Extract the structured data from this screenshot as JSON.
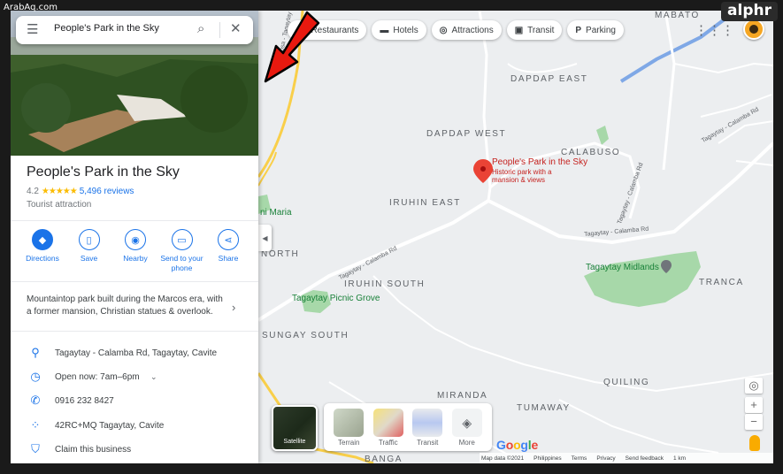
{
  "watermark": "ArabAq.com",
  "brand": "alphr",
  "search": {
    "value": "People's Park in the Sky"
  },
  "place": {
    "name": "People's Park in the Sky",
    "rating": "4.2",
    "stars": "★★★★★",
    "reviews": "5,496 reviews",
    "category": "Tourist attraction",
    "description": "Mountaintop park built during the Marcos era, with a former mansion, Christian statues & overlook."
  },
  "actions": [
    {
      "label": "Directions",
      "icon": "directions-icon"
    },
    {
      "label": "Save",
      "icon": "bookmark-icon"
    },
    {
      "label": "Nearby",
      "icon": "nearby-icon"
    },
    {
      "label": "Send to your phone",
      "icon": "phone-send-icon"
    },
    {
      "label": "Share",
      "icon": "share-icon"
    }
  ],
  "info": {
    "address": "Tagaytay - Calamba Rd, Tagaytay, Cavite",
    "hours": "Open now:  7am–6pm",
    "phone": "0916 232 8427",
    "plus_code": "42RC+MQ Tagaytay, Cavite",
    "claim": "Claim this business"
  },
  "chips": [
    {
      "label": "Restaurants",
      "icon": "restaurant-icon"
    },
    {
      "label": "Hotels",
      "icon": "hotel-icon"
    },
    {
      "label": "Attractions",
      "icon": "attractions-icon"
    },
    {
      "label": "Transit",
      "icon": "transit-icon"
    },
    {
      "label": "Parking",
      "icon": "parking-icon"
    }
  ],
  "map": {
    "areas": [
      "MABATO",
      "DAPDAP EAST",
      "DAPDAP WEST",
      "CALABUSO",
      "IRUHIN EAST",
      "IRUHIN SOUTH",
      "SUNGAY SOUTH",
      "NORTH",
      "TRANCA",
      "QUILING",
      "MIRANDA",
      "TUMAWAY",
      "BANGA"
    ],
    "marker_title": "People's Park in the Sky",
    "marker_sub": "Historic park with a mansion & views",
    "greens": [
      "Tagaytay Midlands",
      "Tagaytay Picnic Grove",
      "ni Maria"
    ],
    "roads": [
      "Santa Rosa - Tagaytay Rd",
      "Tagaytay - Calamba Rd",
      "Tagaytay - Calamba Rd",
      "Tagaytay - Calamba Rd",
      "Tagaytay - Calamba Rd"
    ]
  },
  "layers": {
    "satellite": "Satellite",
    "items": [
      "Terrain",
      "Traffic",
      "Transit",
      "More"
    ]
  },
  "google": "Google",
  "footer": [
    "Map data ©2021",
    "Philippines",
    "Terms",
    "Privacy",
    "Send feedback",
    "1 km"
  ]
}
